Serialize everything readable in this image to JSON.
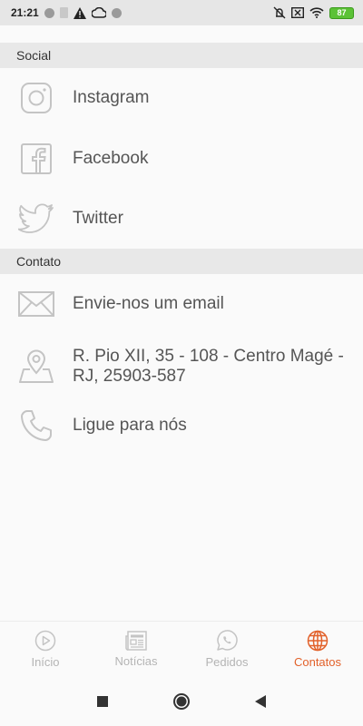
{
  "status_bar": {
    "time": "21:21",
    "battery": "87"
  },
  "sections": [
    {
      "title": "Social",
      "items": [
        {
          "label": "Instagram",
          "icon": "instagram-icon"
        },
        {
          "label": "Facebook",
          "icon": "facebook-icon"
        },
        {
          "label": "Twitter",
          "icon": "twitter-icon"
        }
      ]
    },
    {
      "title": "Contato",
      "items": [
        {
          "label": "Envie-nos um email",
          "icon": "envelope-icon"
        },
        {
          "label": "R. Pio XII, 35 - 108 - Centro Magé - RJ, 25903-587",
          "icon": "map-pin-icon"
        },
        {
          "label": "Ligue para nós",
          "icon": "phone-icon"
        }
      ]
    }
  ],
  "bottom_nav": {
    "items": [
      {
        "label": "Início",
        "icon": "play-circle-icon"
      },
      {
        "label": "Notícias",
        "icon": "newspaper-icon"
      },
      {
        "label": "Pedidos",
        "icon": "whatsapp-icon"
      },
      {
        "label": "Contatos",
        "icon": "globe-icon"
      }
    ],
    "active": "Contatos"
  },
  "colors": {
    "accent": "#e2612a",
    "inactive": "#b4b4b4",
    "section_header_bg": "#e8e8e8",
    "icon_gray": "#c4c4c4"
  }
}
